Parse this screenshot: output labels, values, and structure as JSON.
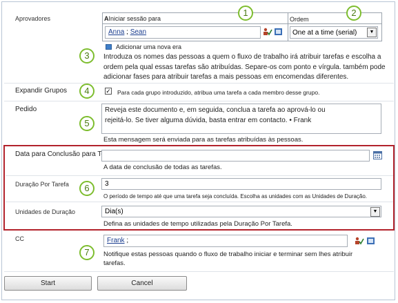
{
  "approvers": {
    "label": "Aprovadores",
    "col_assign": "Iniciar sessão para",
    "col_assign_prefix": "A",
    "col_order": "Ordem",
    "names": [
      "Anna",
      "Sean"
    ],
    "names_separator": " ; ",
    "order_value": "One at a time (serial)",
    "add_stage": "Adicionar uma nova era",
    "help": "Introduza os nomes das pessoas a quem o fluxo de trabalho irá atribuir tarefas e escolha a ordem pela qual essas tarefas são atribuídas. Separe-os com ponto e vírgula. também pode adicionar fases para atribuir tarefas a mais pessoas em encomendas diferentes."
  },
  "expand_groups": {
    "label": "Expandir Grupos",
    "checkbox_text": "Para cada grupo introduzido, atribua uma tarefa a cada membro desse grupo."
  },
  "request": {
    "label": "Pedido",
    "value": "Reveja este documento e, em seguida, conclua a tarefa ao aprová-lo ou rejeitá-lo. Se tiver alguma dúvida, basta entrar em contacto. • Frank",
    "help": "Esta mensagem será enviada para as tarefas atribuídas às pessoas."
  },
  "due_date": {
    "label": "Data para Conclusão para Todas as Tarefas",
    "help": "A data de conclusão de todas as tarefas."
  },
  "duration": {
    "label": "Duração Por Tarefa",
    "value": "3",
    "help": "O período de tempo até que uma tarefa seja concluída. Escolha as unidades com as Unidades de Duração."
  },
  "duration_units": {
    "label": "Unidades de Duração",
    "value": "Dia(s)",
    "help": "Defina as unidades de tempo utilizadas pela Duração Por Tarefa."
  },
  "cc": {
    "label": "CC",
    "names": [
      "Frank"
    ],
    "trailing": " ;",
    "help": "Notifique estas pessoas quando o fluxo de trabalho iniciar e terminar sem lhes atribuir tarefas."
  },
  "buttons": {
    "start": "Start",
    "cancel": "Cancel"
  },
  "callouts": [
    "1",
    "2",
    "3",
    "4",
    "5",
    "6",
    "7"
  ],
  "colors": {
    "highlight_border": "#b2222b",
    "callout_border": "#7dbd2e",
    "link": "#1a3d8f"
  }
}
